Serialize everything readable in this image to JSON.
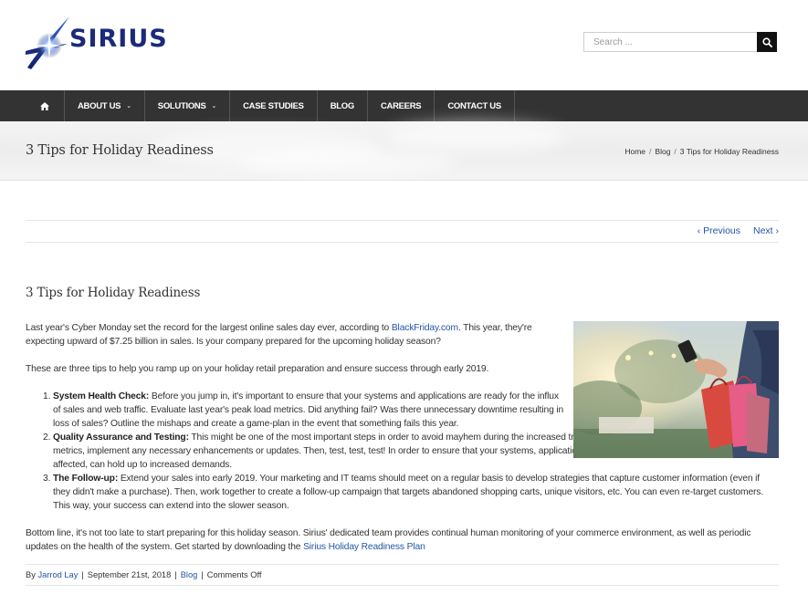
{
  "brand": {
    "name": "SIRIUS"
  },
  "search": {
    "placeholder": "Search ..."
  },
  "nav": {
    "items": [
      {
        "label": "ABOUT US",
        "has_dropdown": true
      },
      {
        "label": "SOLUTIONS",
        "has_dropdown": true
      },
      {
        "label": "CASE STUDIES",
        "has_dropdown": false
      },
      {
        "label": "BLOG",
        "has_dropdown": false
      },
      {
        "label": "CAREERS",
        "has_dropdown": false
      },
      {
        "label": "CONTACT US",
        "has_dropdown": false
      }
    ],
    "home_icon": "home-icon"
  },
  "page": {
    "title": "3 Tips for Holiday Readiness",
    "breadcrumbs": [
      "Home",
      "Blog",
      "3 Tips for Holiday Readiness"
    ]
  },
  "pager": {
    "previous": "Previous",
    "next": "Next"
  },
  "article": {
    "title": "3 Tips for Holiday Readiness",
    "intro_before_link": "Last year's Cyber Monday set the record for the largest online sales day ever, according to ",
    "intro_link": "BlackFriday.com",
    "intro_after_link": ". This year, they're expecting upward of $7.25 billion in sales. Is your company prepared for the upcoming holiday season?",
    "lead": "These are three tips to help you ramp up on your holiday retail preparation and ensure success through early 2019.",
    "tips": [
      {
        "heading": "System Health Check:",
        "text": " Before you jump in, it's important to ensure that your systems and applications are ready for the influx of sales and web traffic. Evaluate last year's peak load metrics. Did anything fail? Was there unnecessary downtime resulting in loss of sales? Outline the mishaps and create a game-plan in the event that something fails this year."
      },
      {
        "heading": "Quality Assurance and Testing:",
        "text": " This might be one of the most important steps in order to avoid mayhem during the increased traffic periods. After you evaluate last year's peak metrics, implement any necessary enhancements or updates. Then, test, test, test! In order to ensure that your systems, applications and, who could forget, the various departments affected, can hold up to increased demands."
      },
      {
        "heading": "The Follow-up:",
        "text": " Extend your sales into early 2019. Your marketing and IT teams should meet on a regular basis to develop strategies that capture customer information (even if they didn't make a purchase). Then, work together to create a follow-up campaign that targets abandoned shopping carts, unique visitors, etc. You can even re-target customers. This way, your success can extend into the slower season."
      }
    ],
    "closing_before_link": "Bottom line, it's not too late to start preparing for this holiday season. Sirius' dedicated team provides continual human monitoring of your commerce environment, as well as periodic updates on the health of the system. Get started by downloading the ",
    "closing_link": "Sirius Holiday Readiness Plan"
  },
  "meta": {
    "by": "By ",
    "author": "Jarrod Lay",
    "date": "September 21st, 2018",
    "category": "Blog",
    "comments": "Comments Off"
  },
  "colors": {
    "nav_bg": "#333333",
    "link": "#2356a6",
    "logo": "#1b2b78"
  }
}
